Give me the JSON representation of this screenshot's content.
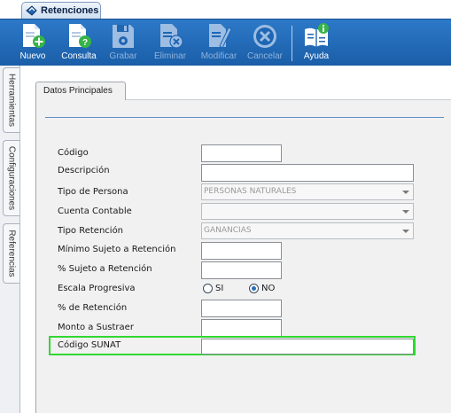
{
  "window_tab": {
    "title": "Retenciones"
  },
  "toolbar": {
    "buttons": [
      {
        "label": "Nuevo",
        "icon": "new-document-icon",
        "enabled": true
      },
      {
        "label": "Consulta",
        "icon": "query-document-icon",
        "enabled": true
      },
      {
        "label": "Grabar",
        "icon": "save-disk-icon",
        "enabled": false
      },
      {
        "label": "Eliminar",
        "icon": "delete-document-icon",
        "enabled": false
      },
      {
        "label": "Modificar",
        "icon": "edit-document-icon",
        "enabled": false
      },
      {
        "label": "Cancelar",
        "icon": "cancel-circle-icon",
        "enabled": false
      },
      {
        "label": "Ayuda",
        "icon": "help-book-icon",
        "enabled": true
      }
    ]
  },
  "side_tabs": [
    "Herramientas",
    "Configuraciones",
    "Referencias"
  ],
  "form": {
    "tab_label": "Datos Principales",
    "codigo_label": "Código",
    "codigo_value": "",
    "descripcion_label": "Descripción",
    "descripcion_value": "",
    "tipo_persona_label": "Tipo de Persona",
    "tipo_persona_value": "PERSONAS NATURALES",
    "cuenta_contable_label": "Cuenta Contable",
    "cuenta_contable_value": "",
    "tipo_retencion_label": "Tipo Retención",
    "tipo_retencion_value": "GANANCIAS",
    "minimo_label": "Mínimo Sujeto a Retención",
    "minimo_value": "",
    "pct_sujeto_label": "% Sujeto a Retención",
    "pct_sujeto_value": "",
    "escala_label": "Escala Progresiva",
    "escala_si": "SI",
    "escala_no": "NO",
    "escala_selected": "NO",
    "pct_retencion_label": "% de Retención",
    "pct_retencion_value": "",
    "monto_label": "Monto a Sustraer",
    "monto_value": "",
    "sunat_label": "Código SUNAT",
    "sunat_value": ""
  },
  "colors": {
    "toolbar": "#1f66b3",
    "highlight": "#32d832",
    "icon_fill": "#ffffff",
    "icon_disabled": "#9dbde3",
    "badge_green": "#37b449"
  }
}
